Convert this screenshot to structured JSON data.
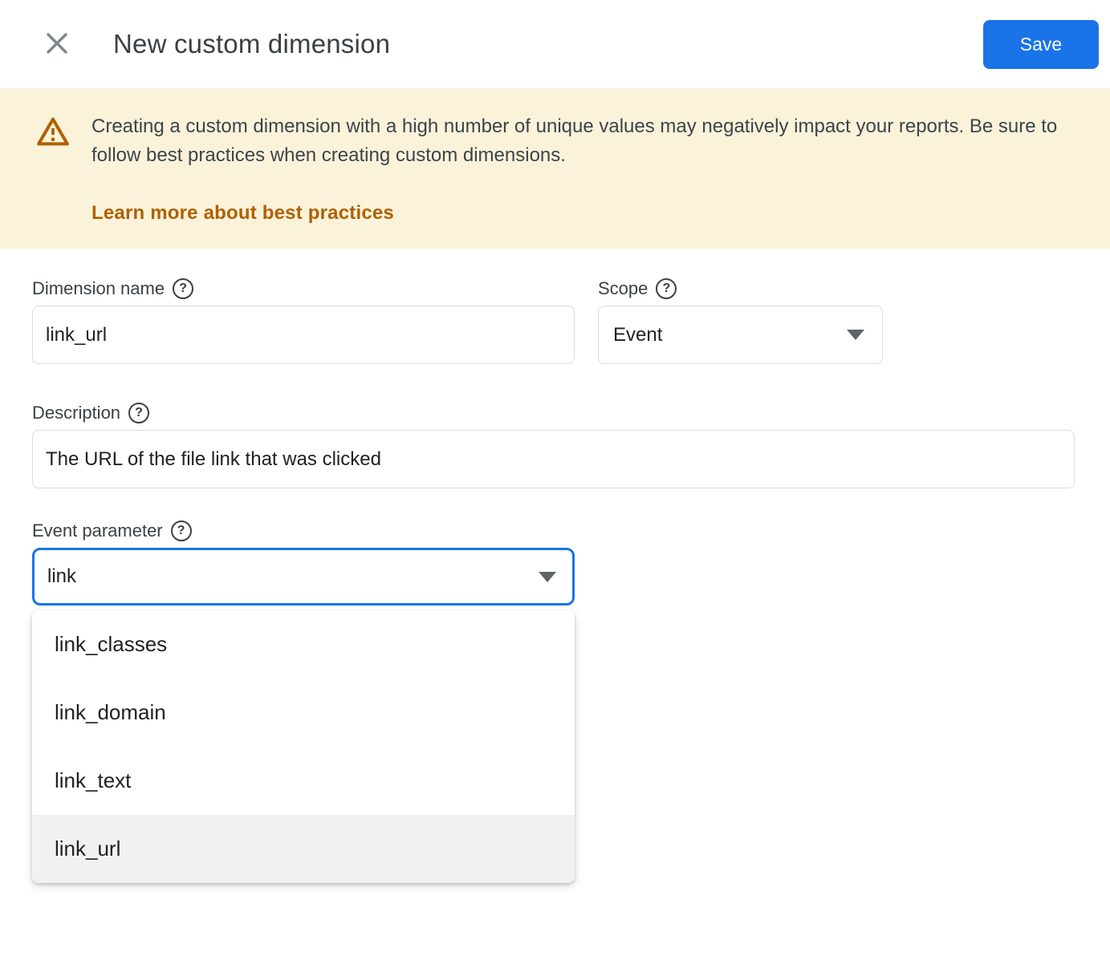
{
  "header": {
    "title": "New custom dimension",
    "save_label": "Save"
  },
  "banner": {
    "message": "Creating a custom dimension with a high number of unique values may negatively impact your reports. Be sure to follow best practices when creating custom dimensions.",
    "link_label": "Learn more about best practices"
  },
  "form": {
    "dimension_name": {
      "label": "Dimension name",
      "value": "link_url"
    },
    "scope": {
      "label": "Scope",
      "value": "Event"
    },
    "description": {
      "label": "Description",
      "value": "The URL of the file link that was clicked"
    },
    "event_parameter": {
      "label": "Event parameter",
      "value": "link"
    }
  },
  "dropdown": {
    "options": [
      {
        "label": "link_classes",
        "highlighted": false
      },
      {
        "label": "link_domain",
        "highlighted": false
      },
      {
        "label": "link_text",
        "highlighted": false
      },
      {
        "label": "link_url",
        "highlighted": true
      }
    ]
  },
  "colors": {
    "primary_blue": "#1a73e8",
    "banner_background": "#faf3da",
    "warning_accent": "#b06000",
    "border_gray": "#dadce0",
    "highlight_gray": "#f1f1f1",
    "text_dark": "#202124"
  }
}
